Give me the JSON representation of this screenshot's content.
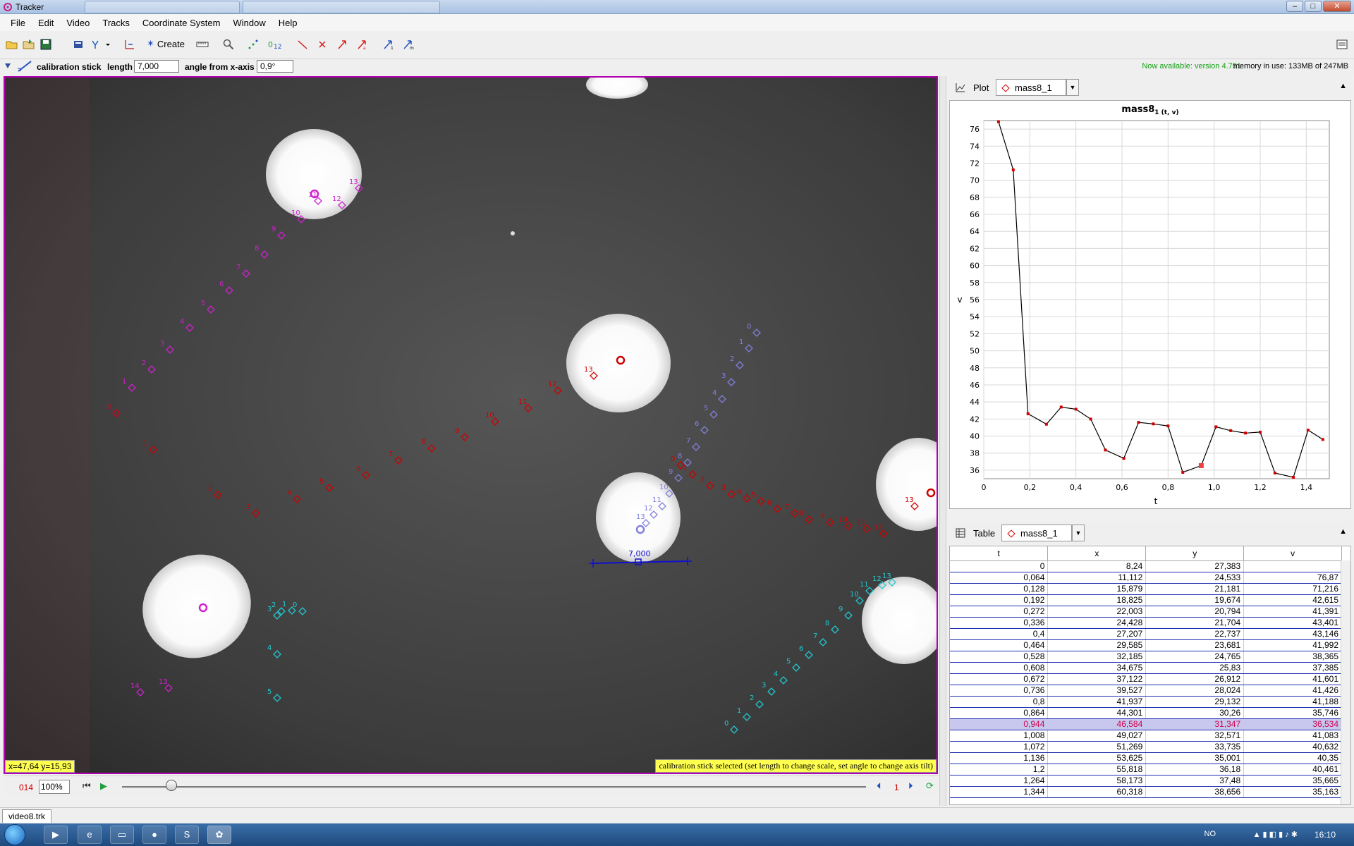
{
  "window": {
    "title": "Tracker",
    "min": "–",
    "max": "□",
    "close": "✕"
  },
  "menus": [
    "File",
    "Edit",
    "Video",
    "Tracks",
    "Coordinate System",
    "Window",
    "Help"
  ],
  "toolbar": {
    "create_label": "Create"
  },
  "trackbar": {
    "track_name": "calibration stick",
    "length_label": "length",
    "length_value": "7,000",
    "angle_label": "angle from x-axis",
    "angle_value": "0,9°",
    "update_notice": "Now available: version 4.751",
    "memory": "memory in use: 133MB of 247MB"
  },
  "video": {
    "coord_readout": "x=47,64  y=15,93",
    "status_message": "calibration stick selected (set length to change scale, set angle to change axis tilt)",
    "stick_label": "7,000"
  },
  "player": {
    "frame": "014",
    "zoom": "100%",
    "step": "1"
  },
  "plot": {
    "panel_label": "Plot",
    "track": "mass8_1",
    "title_main": "mass8",
    "title_sub": "1 (t, v)",
    "chart_data": {
      "type": "line",
      "title": "mass8 1 (t, v)",
      "xlabel": "t",
      "ylabel": "v",
      "xlim": [
        0,
        1.5
      ],
      "ylim": [
        35,
        77
      ],
      "x_ticks": [
        "0",
        "0,2",
        "0,4",
        "0,6",
        "0,8",
        "1,0",
        "1,2",
        "1,4"
      ],
      "y_ticks": [
        "36",
        "38",
        "40",
        "42",
        "44",
        "46",
        "48",
        "50",
        "52",
        "54",
        "56",
        "58",
        "60",
        "62",
        "64",
        "66",
        "68",
        "70",
        "72",
        "74",
        "76"
      ],
      "grid": true,
      "highlight_index": 14,
      "series": [
        {
          "x": [
            0.064,
            0.128,
            0.192,
            0.272,
            0.336,
            0.4,
            0.464,
            0.528,
            0.608,
            0.672,
            0.736,
            0.8,
            0.864,
            0.944,
            1.008,
            1.072,
            1.136,
            1.2,
            1.264,
            1.344,
            1.408,
            1.472
          ],
          "values": [
            76.87,
            71.216,
            42.615,
            41.391,
            43.401,
            43.146,
            41.992,
            38.365,
            37.385,
            41.601,
            41.426,
            41.188,
            35.746,
            36.534,
            41.083,
            40.632,
            40.35,
            40.461,
            35.665,
            35.163,
            40.7,
            39.6
          ]
        }
      ]
    }
  },
  "table": {
    "panel_label": "Table",
    "track": "mass8_1",
    "columns": [
      "t",
      "x",
      "y",
      "v"
    ],
    "selected_row": 14,
    "rows": [
      [
        "0",
        "8,24",
        "27,383",
        ""
      ],
      [
        "0,064",
        "11,112",
        "24,533",
        "76,87"
      ],
      [
        "0,128",
        "15,879",
        "21,181",
        "71,216"
      ],
      [
        "0,192",
        "18,825",
        "19,674",
        "42,615"
      ],
      [
        "0,272",
        "22,003",
        "20,794",
        "41,391"
      ],
      [
        "0,336",
        "24,428",
        "21,704",
        "43,401"
      ],
      [
        "0,4",
        "27,207",
        "22,737",
        "43,146"
      ],
      [
        "0,464",
        "29,585",
        "23,681",
        "41,992"
      ],
      [
        "0,528",
        "32,185",
        "24,765",
        "38,365"
      ],
      [
        "0,608",
        "34,675",
        "25,83",
        "37,385"
      ],
      [
        "0,672",
        "37,122",
        "26,912",
        "41,601"
      ],
      [
        "0,736",
        "39,527",
        "28,024",
        "41,426"
      ],
      [
        "0,8",
        "41,937",
        "29,132",
        "41,188"
      ],
      [
        "0,864",
        "44,301",
        "30,26",
        "35,746"
      ],
      [
        "0,944",
        "46,584",
        "31,347",
        "36,534"
      ],
      [
        "1,008",
        "49,027",
        "32,571",
        "41,083"
      ],
      [
        "1,072",
        "51,269",
        "33,735",
        "40,632"
      ],
      [
        "1,136",
        "53,625",
        "35,001",
        "40,35"
      ],
      [
        "1,2",
        "55,818",
        "36,18",
        "40,461"
      ],
      [
        "1,264",
        "58,173",
        "37,48",
        "35,665"
      ],
      [
        "1,344",
        "60,318",
        "38,656",
        "35,163"
      ]
    ]
  },
  "file_tab": "video8.trk",
  "taskbar": {
    "lang": "NO",
    "clock": "16:10"
  },
  "colors": {
    "accent_red": "#d00000",
    "magenta": "#d020d0",
    "lavender": "#8080e0",
    "cyan": "#20c8d0",
    "stick_blue": "#1010d0",
    "notice_green": "#14a014"
  }
}
